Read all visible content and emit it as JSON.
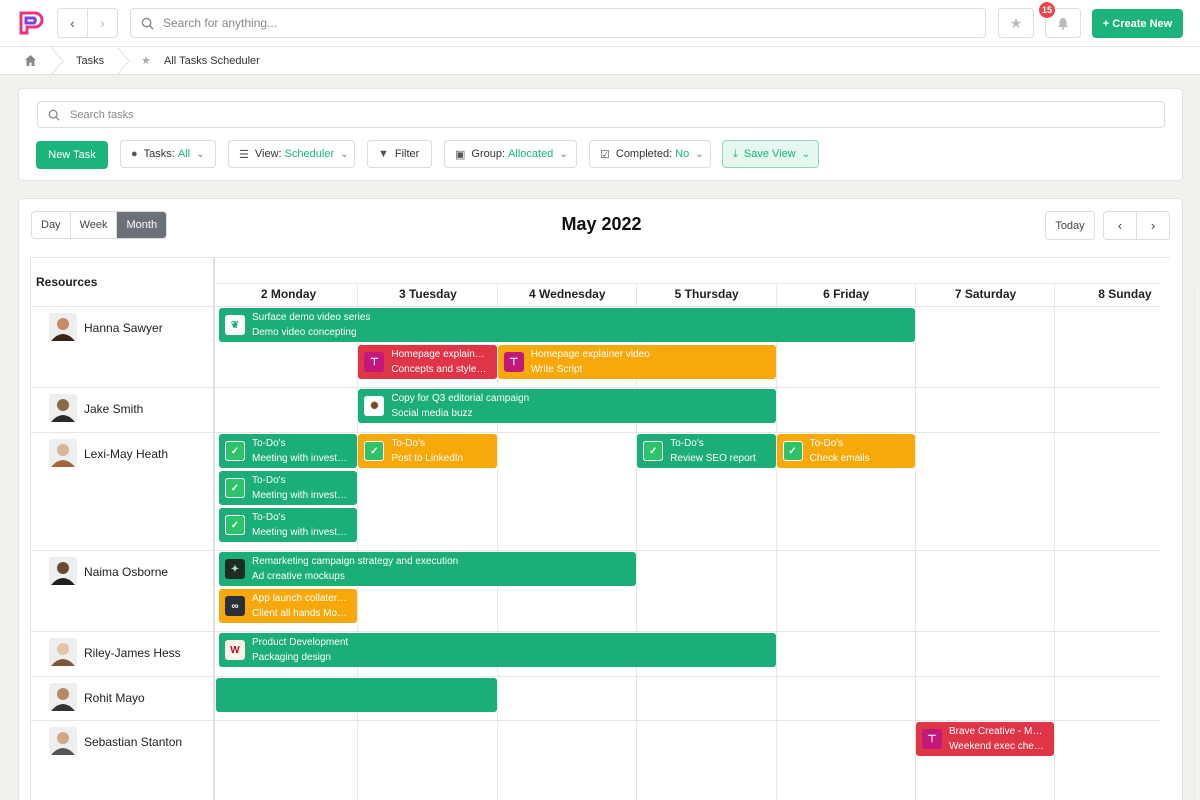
{
  "topbar": {
    "search_placeholder": "Search for anything...",
    "notification_count": "15",
    "create_label": "+ Create New"
  },
  "breadcrumb": {
    "items": [
      "Tasks",
      "All Tasks Scheduler"
    ]
  },
  "filters": {
    "search_placeholder": "Search tasks",
    "new_task": "New Task",
    "tasks": {
      "label": "Tasks:",
      "value": "All"
    },
    "view": {
      "label": "View:",
      "value": "Scheduler"
    },
    "filter": {
      "label": "Filter"
    },
    "group": {
      "label": "Group:",
      "value": "Allocated"
    },
    "completed": {
      "label": "Completed:",
      "value": "No"
    },
    "save_view": {
      "label": "Save View"
    }
  },
  "scheduler": {
    "view_modes": [
      "Day",
      "Week",
      "Month"
    ],
    "active_view": "Month",
    "month_title": "May 2022",
    "today_label": "Today",
    "resources_header": "Resources",
    "days": [
      "2 Monday",
      "3 Tuesday",
      "4 Wednesday",
      "5 Thursday",
      "6 Friday",
      "7 Saturday",
      "8 Sunday"
    ],
    "resources": [
      {
        "name": "Hanna Sawyer"
      },
      {
        "name": "Jake Smith"
      },
      {
        "name": "Lexi-May Heath"
      },
      {
        "name": "Naima Osborne"
      },
      {
        "name": "Riley-James Hess"
      },
      {
        "name": "Rohit Mayo"
      },
      {
        "name": "Sebastian Stanton"
      }
    ],
    "events": [
      {
        "resource": "Hanna Sawyer",
        "title": "Surface demo video series",
        "subtitle": "Demo video concepting",
        "color": "#1bae78",
        "start_day": "2 Monday",
        "end_day": "6 Friday",
        "icon": "leaf-logo-icon"
      },
      {
        "resource": "Hanna Sawyer",
        "title": "Homepage explain…",
        "subtitle": "Concepts and style…",
        "color": "#e03546",
        "start_day": "3 Tuesday",
        "end_day": "3 Tuesday",
        "icon": "brand-logo-icon"
      },
      {
        "resource": "Hanna Sawyer",
        "title": "Homepage explainer video",
        "subtitle": "Write Script",
        "color": "#f7a90c",
        "start_day": "4 Wednesday",
        "end_day": "5 Thursday",
        "icon": "brand-logo-icon"
      },
      {
        "resource": "Jake Smith",
        "title": "Copy for Q3 editorial campaign",
        "subtitle": "Social media buzz",
        "color": "#1bae78",
        "start_day": "3 Tuesday",
        "end_day": "5 Thursday",
        "icon": "badge-logo-icon"
      },
      {
        "resource": "Lexi-May Heath",
        "title": "To-Do's",
        "subtitle": "Meeting with invest…",
        "color": "#1bae78",
        "start_day": "2 Monday",
        "end_day": "2 Monday",
        "icon": "check-icon"
      },
      {
        "resource": "Lexi-May Heath",
        "title": "To-Do's",
        "subtitle": "Post to LinkedIn",
        "color": "#f7a90c",
        "start_day": "3 Tuesday",
        "end_day": "3 Tuesday",
        "icon": "check-icon"
      },
      {
        "resource": "Lexi-May Heath",
        "title": "To-Do's",
        "subtitle": "Review SEO report",
        "color": "#1bae78",
        "start_day": "5 Thursday",
        "end_day": "5 Thursday",
        "icon": "check-icon"
      },
      {
        "resource": "Lexi-May Heath",
        "title": "To-Do's",
        "subtitle": "Check emails",
        "color": "#f7a90c",
        "start_day": "6 Friday",
        "end_day": "6 Friday",
        "icon": "check-icon"
      },
      {
        "resource": "Lexi-May Heath",
        "title": "To-Do's",
        "subtitle": "Meeting with invest…",
        "color": "#1bae78",
        "start_day": "2 Monday",
        "end_day": "2 Monday",
        "icon": "check-icon"
      },
      {
        "resource": "Lexi-May Heath",
        "title": "To-Do's",
        "subtitle": "Meeting with invest…",
        "color": "#1bae78",
        "start_day": "2 Monday",
        "end_day": "2 Monday",
        "icon": "check-icon"
      },
      {
        "resource": "Naima Osborne",
        "title": "Remarketing campaign strategy and execution",
        "subtitle": "Ad creative mockups",
        "color": "#1bae78",
        "start_day": "2 Monday",
        "end_day": "4 Wednesday",
        "icon": "dark-logo-icon"
      },
      {
        "resource": "Naima Osborne",
        "title": "App launch collater…",
        "subtitle": "Client all hands Mo…",
        "color": "#f7a90c",
        "start_day": "2 Monday",
        "end_day": "2 Monday",
        "icon": "infinity-logo-icon"
      },
      {
        "resource": "Riley-James Hess",
        "title": "Product Development",
        "subtitle": "Packaging design",
        "color": "#1bae78",
        "start_day": "2 Monday",
        "end_day": "5 Thursday",
        "icon": "w-logo-icon"
      },
      {
        "resource": "Rohit Mayo",
        "title": "",
        "subtitle": "",
        "color": "#1bae78",
        "start_day": "2 Monday",
        "end_day": "3 Tuesday",
        "icon": ""
      },
      {
        "resource": "Sebastian Stanton",
        "title": "Brave Creative - M…",
        "subtitle": "Weekend exec che…",
        "color": "#e03546",
        "start_day": "7 Saturday",
        "end_day": "7 Saturday",
        "icon": "brand-logo-icon"
      }
    ]
  }
}
